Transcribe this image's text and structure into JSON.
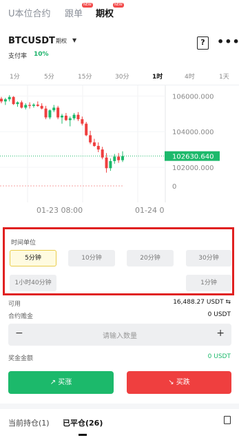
{
  "top_tabs": [
    {
      "label": "U本位合约",
      "active": false,
      "badge": ""
    },
    {
      "label": "跟单",
      "active": false,
      "badge": "NEW"
    },
    {
      "label": "期权",
      "active": true,
      "badge": "NEW"
    }
  ],
  "header": {
    "symbol": "BTCUSDT",
    "symbol_tag": "期权",
    "funding_label": "支付率",
    "funding_value": "10%"
  },
  "intervals": [
    {
      "label": "1分",
      "active": false
    },
    {
      "label": "5分",
      "active": false
    },
    {
      "label": "15分",
      "active": false
    },
    {
      "label": "30分",
      "active": false
    },
    {
      "label": "1时",
      "active": true
    },
    {
      "label": "4时",
      "active": false
    },
    {
      "label": "1天",
      "active": false
    }
  ],
  "chart_data": {
    "type": "candlestick",
    "y_ticks": [
      "106000.000",
      "104000.000",
      "102000.000"
    ],
    "ylim": [
      100800,
      106600
    ],
    "current_price": "102630.640",
    "current_price_value": 102630.64,
    "volume_axis_label": "0",
    "x_ticks": [
      "01-23 08:00",
      "01-24 0"
    ],
    "candles": [
      [
        105850,
        105950,
        105600,
        105700
      ],
      [
        105700,
        105900,
        105500,
        105820
      ],
      [
        105820,
        106050,
        105700,
        105950
      ],
      [
        105950,
        106000,
        105500,
        105550
      ],
      [
        105550,
        105700,
        105400,
        105650
      ],
      [
        105650,
        105750,
        105300,
        105350
      ],
      [
        105350,
        105600,
        105250,
        105500
      ],
      [
        105500,
        105650,
        105300,
        105450
      ],
      [
        105450,
        105600,
        105350,
        105520
      ],
      [
        105520,
        105700,
        105400,
        105450
      ],
      [
        105450,
        105600,
        105250,
        105300
      ],
      [
        105300,
        105450,
        104700,
        104800
      ],
      [
        104800,
        105250,
        104700,
        105200
      ],
      [
        105200,
        105500,
        105100,
        105350
      ],
      [
        105350,
        105450,
        104700,
        104800
      ],
      [
        104800,
        105000,
        104450,
        104900
      ],
      [
        104900,
        105050,
        104600,
        104650
      ],
      [
        104650,
        104850,
        104300,
        104750
      ],
      [
        104750,
        105050,
        104650,
        104950
      ],
      [
        104950,
        105100,
        104600,
        104700
      ],
      [
        104700,
        104850,
        104350,
        104450
      ],
      [
        104450,
        104550,
        103750,
        103800
      ],
      [
        103800,
        104050,
        103300,
        103400
      ],
      [
        103400,
        103600,
        103150,
        103200
      ],
      [
        103200,
        103400,
        102850,
        103000
      ],
      [
        103000,
        103150,
        102450,
        102550
      ],
      [
        102550,
        102800,
        101700,
        101950
      ],
      [
        101950,
        102500,
        101800,
        102350
      ],
      [
        102350,
        102750,
        102200,
        102600
      ],
      [
        102600,
        102800,
        102250,
        102400
      ],
      [
        102400,
        102900,
        102300,
        102630
      ]
    ],
    "colors": {
      "up": "#1cb96b",
      "down": "#ef3f3f",
      "price_tag": "#1cb96b"
    }
  },
  "duration": {
    "title": "时间单位",
    "options": [
      {
        "label": "5分钟",
        "active": true
      },
      {
        "label": "10分钟",
        "active": false
      },
      {
        "label": "20分钟",
        "active": false
      },
      {
        "label": "30分钟",
        "active": false
      },
      {
        "label": "1小时40分钟",
        "active": false
      },
      {
        "label": "1分钟",
        "active": false
      }
    ]
  },
  "account": {
    "available_label": "可用",
    "available_value": "16,488.27 USDT ⇆",
    "margin_label": "合约赡金",
    "margin_value": "0 USDT",
    "quantity_placeholder": "请输入数量",
    "minus": "−",
    "plus": "+",
    "bonus_label": "奖金金额",
    "bonus_value": "0 USDT"
  },
  "actions": {
    "up_label": "↗  买涨",
    "down_label": "↘  买跌"
  },
  "bottom_tabs": [
    {
      "label": "当前持仓(1)",
      "active": false
    },
    {
      "label": "已平仓(26)",
      "active": true
    }
  ]
}
